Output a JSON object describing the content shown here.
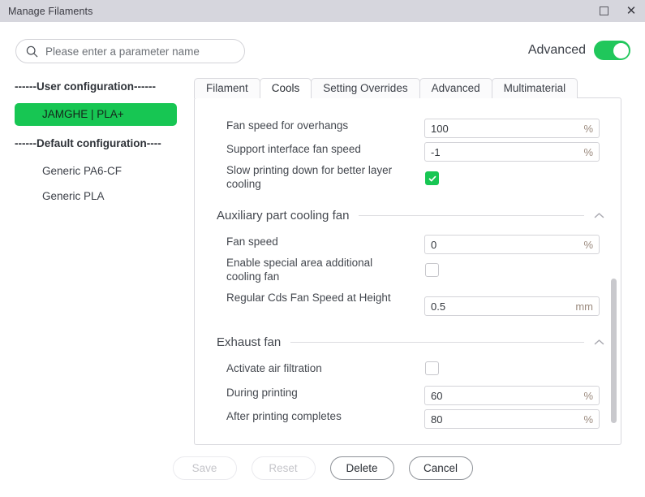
{
  "window": {
    "title": "Manage Filaments",
    "controls": [
      {
        "name": "maximize",
        "glyph": "maximize-icon"
      },
      {
        "name": "close",
        "glyph": "close-icon"
      }
    ]
  },
  "search": {
    "placeholder": "Please enter a parameter name",
    "value": "",
    "icon": "search-icon"
  },
  "advanced": {
    "label": "Advanced",
    "enabled": true,
    "accent_color": "#20c75b"
  },
  "sidebar": {
    "groups": [
      {
        "header": "------User configuration------",
        "items": [
          {
            "label": "JAMGHE | PLA+",
            "selected": true
          }
        ]
      },
      {
        "header": "------Default configuration----",
        "items": [
          {
            "label": "Generic PA6-CF",
            "selected": false
          },
          {
            "label": "Generic PLA",
            "selected": false
          }
        ]
      }
    ],
    "selected_color": "#17c653"
  },
  "tabs": [
    {
      "label": "Filament",
      "active": false
    },
    {
      "label": "Cools",
      "active": true
    },
    {
      "label": "Setting Overrides",
      "active": false
    },
    {
      "label": "Advanced",
      "active": false
    },
    {
      "label": "Multimaterial",
      "active": false
    }
  ],
  "form": {
    "top_rows": [
      {
        "label": "Fan speed for overhangs",
        "type": "text",
        "value": "100",
        "unit": "%"
      },
      {
        "label": "Support interface fan speed",
        "type": "text",
        "value": "-1",
        "unit": "%"
      },
      {
        "label": "Slow printing down for better layer cooling",
        "type": "checkbox",
        "checked": true
      }
    ],
    "sections": [
      {
        "title": "Auxiliary part cooling fan",
        "collapsed": false,
        "chevron": "chevron-up-icon",
        "rows": [
          {
            "label": "Fan speed",
            "type": "text",
            "value": "0",
            "unit": "%"
          },
          {
            "label": "Enable special area additional cooling fan",
            "type": "checkbox",
            "checked": false
          },
          {
            "label": "Regular Cds Fan Speed at Height",
            "type": "text",
            "value": "0.5",
            "unit": "mm"
          }
        ]
      },
      {
        "title": "Exhaust fan",
        "collapsed": false,
        "chevron": "chevron-up-icon",
        "rows": [
          {
            "label": "Activate air filtration",
            "type": "checkbox",
            "checked": false
          },
          {
            "label": "During printing",
            "type": "text",
            "value": "60",
            "unit": "%"
          },
          {
            "label": "After printing completes",
            "type": "text",
            "value": "80",
            "unit": "%"
          }
        ]
      }
    ]
  },
  "footer": {
    "buttons": [
      {
        "label": "Save",
        "disabled": true
      },
      {
        "label": "Reset",
        "disabled": true
      },
      {
        "label": "Delete",
        "disabled": false,
        "strong": true
      },
      {
        "label": "Cancel",
        "disabled": false,
        "strong": true
      }
    ]
  }
}
